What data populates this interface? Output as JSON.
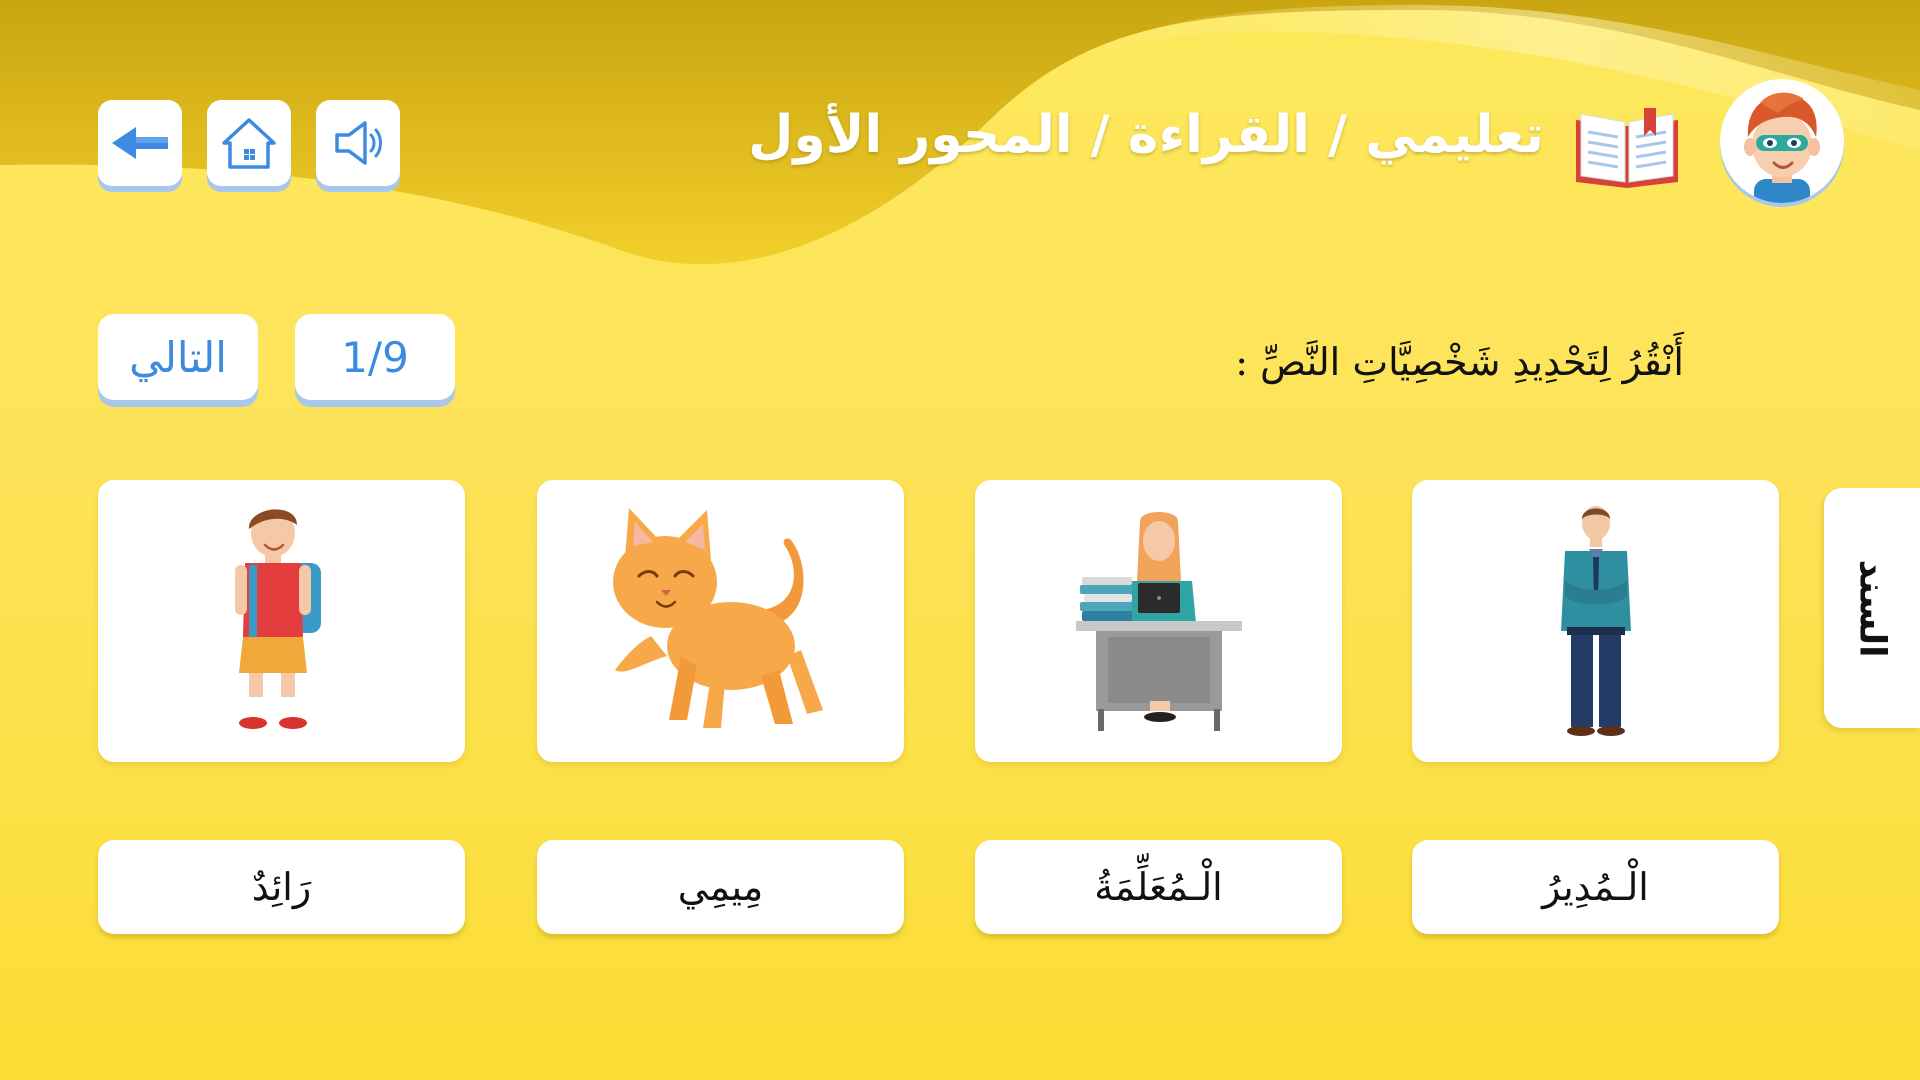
{
  "header": {
    "breadcrumb": "تعليمي / القراءة / المحور الأول",
    "icons": {
      "back": "arrow-left-icon",
      "home": "home-icon",
      "audio": "speaker-icon",
      "book": "book-icon",
      "avatar": "boy-avatar"
    }
  },
  "navigation": {
    "next_label": "التالي",
    "progress": "1/9"
  },
  "instruction": "أَنْقُرُ لِتَحْدِيدِ شَخْصِيَّاتِ النَّصِّ :",
  "cards": [
    {
      "image": "principal-man-illustration",
      "label": "الْـمُدِيرُ"
    },
    {
      "image": "teacher-at-desk-illustration",
      "label": "الْـمُعَلِّمَةُ"
    },
    {
      "image": "orange-cat-illustration",
      "label": "مِيمِي"
    },
    {
      "image": "schoolboy-with-backpack-illustration",
      "label": "رَائِدٌ"
    }
  ],
  "side_tab": {
    "label": "السند"
  },
  "colors": {
    "background": "#fde35a",
    "accent_blue": "#3d8be0",
    "button_shadow": "#a9c6ec",
    "wave_dark": "#c9a511"
  }
}
